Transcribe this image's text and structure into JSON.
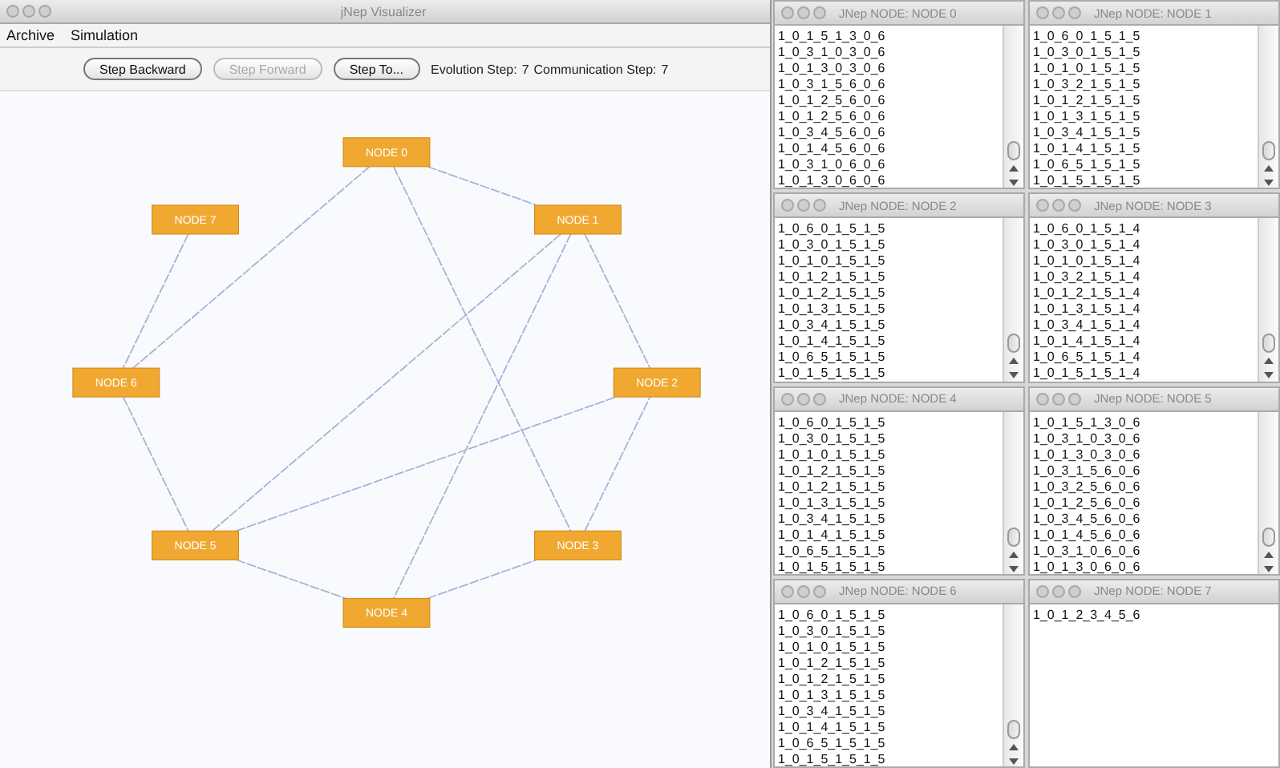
{
  "main_window": {
    "title": "jNep Visualizer"
  },
  "menu": [
    "Archive",
    "Simulation"
  ],
  "toolbar": {
    "buttons": [
      {
        "label": "Step Backward",
        "disabled": false
      },
      {
        "label": "Step Forward",
        "disabled": true
      },
      {
        "label": "Step To...",
        "disabled": false
      }
    ],
    "status": [
      {
        "label": "Evolution Step:",
        "value": "7"
      },
      {
        "label": "Communication Step:",
        "value": "7"
      }
    ]
  },
  "graph": {
    "nodes": [
      "NODE 0",
      "NODE 1",
      "NODE 2",
      "NODE 3",
      "NODE 4",
      "NODE 5",
      "NODE 6",
      "NODE 7"
    ]
  },
  "node_windows": [
    {
      "title": "JNep NODE: NODE 0",
      "scrollable": true,
      "lines": [
        "1_0_1_5_1_3_0_6",
        "1_0_3_1_0_3_0_6",
        "1_0_1_3_0_3_0_6",
        "1_0_3_1_5_6_0_6",
        "1_0_1_2_5_6_0_6",
        "1_0_1_2_5_6_0_6",
        "1_0_3_4_5_6_0_6",
        "1_0_1_4_5_6_0_6",
        "1_0_3_1_0_6_0_6",
        "1_0_1_3_0_6_0_6"
      ]
    },
    {
      "title": "JNep NODE: NODE 1",
      "scrollable": true,
      "lines": [
        "1_0_6_0_1_5_1_5",
        "1_0_3_0_1_5_1_5",
        "1_0_1_0_1_5_1_5",
        "1_0_3_2_1_5_1_5",
        "1_0_1_2_1_5_1_5",
        "1_0_1_3_1_5_1_5",
        "1_0_3_4_1_5_1_5",
        "1_0_1_4_1_5_1_5",
        "1_0_6_5_1_5_1_5",
        "1_0_1_5_1_5_1_5"
      ]
    },
    {
      "title": "JNep NODE: NODE 2",
      "scrollable": true,
      "lines": [
        "1_0_6_0_1_5_1_5",
        "1_0_3_0_1_5_1_5",
        "1_0_1_0_1_5_1_5",
        "1_0_1_2_1_5_1_5",
        "1_0_1_2_1_5_1_5",
        "1_0_1_3_1_5_1_5",
        "1_0_3_4_1_5_1_5",
        "1_0_1_4_1_5_1_5",
        "1_0_6_5_1_5_1_5",
        "1_0_1_5_1_5_1_5"
      ]
    },
    {
      "title": "JNep NODE: NODE 3",
      "scrollable": true,
      "lines": [
        "1_0_6_0_1_5_1_4",
        "1_0_3_0_1_5_1_4",
        "1_0_1_0_1_5_1_4",
        "1_0_3_2_1_5_1_4",
        "1_0_1_2_1_5_1_4",
        "1_0_1_3_1_5_1_4",
        "1_0_3_4_1_5_1_4",
        "1_0_1_4_1_5_1_4",
        "1_0_6_5_1_5_1_4",
        "1_0_1_5_1_5_1_4"
      ]
    },
    {
      "title": "JNep NODE: NODE 4",
      "scrollable": true,
      "lines": [
        "1_0_6_0_1_5_1_5",
        "1_0_3_0_1_5_1_5",
        "1_0_1_0_1_5_1_5",
        "1_0_1_2_1_5_1_5",
        "1_0_1_2_1_5_1_5",
        "1_0_1_3_1_5_1_5",
        "1_0_3_4_1_5_1_5",
        "1_0_1_4_1_5_1_5",
        "1_0_6_5_1_5_1_5",
        "1_0_1_5_1_5_1_5"
      ]
    },
    {
      "title": "JNep NODE: NODE 5",
      "scrollable": true,
      "lines": [
        "1_0_1_5_1_3_0_6",
        "1_0_3_1_0_3_0_6",
        "1_0_1_3_0_3_0_6",
        "1_0_3_1_5_6_0_6",
        "1_0_3_2_5_6_0_6",
        "1_0_1_2_5_6_0_6",
        "1_0_3_4_5_6_0_6",
        "1_0_1_4_5_6_0_6",
        "1_0_3_1_0_6_0_6",
        "1_0_1_3_0_6_0_6"
      ]
    },
    {
      "title": "JNep NODE: NODE 6",
      "scrollable": true,
      "lines": [
        "1_0_6_0_1_5_1_5",
        "1_0_3_0_1_5_1_5",
        "1_0_1_0_1_5_1_5",
        "1_0_1_2_1_5_1_5",
        "1_0_1_2_1_5_1_5",
        "1_0_1_3_1_5_1_5",
        "1_0_3_4_1_5_1_5",
        "1_0_1_4_1_5_1_5",
        "1_0_6_5_1_5_1_5",
        "1_0_1_5_1_5_1_5"
      ]
    },
    {
      "title": "JNep NODE: NODE 7",
      "scrollable": false,
      "lines": [
        "1_0_1_2_3_4_5_6"
      ]
    }
  ]
}
